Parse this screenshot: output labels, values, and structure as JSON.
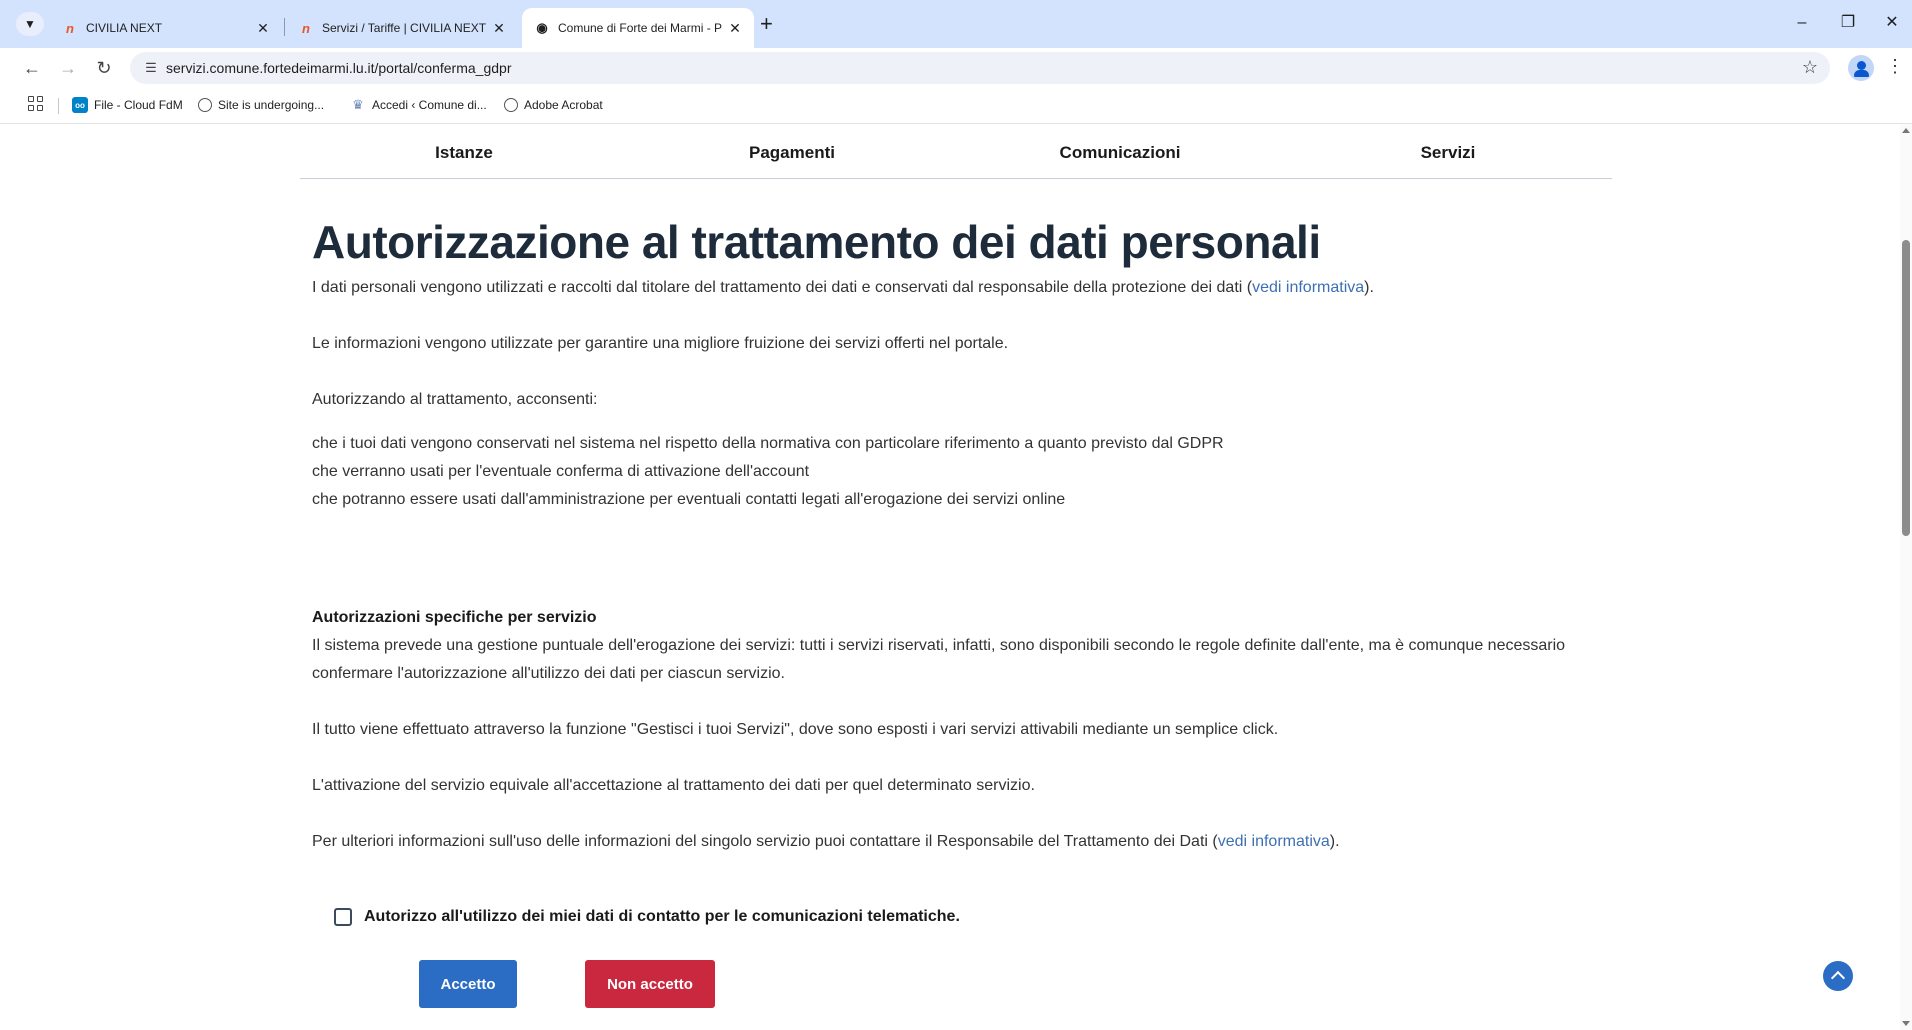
{
  "browser": {
    "tabs": [
      {
        "title": "CIVILIA NEXT",
        "favicon": "civilia-icon",
        "active": false
      },
      {
        "title": "Servizi / Tariffe | CIVILIA NEXT",
        "favicon": "civilia-icon",
        "active": false
      },
      {
        "title": "Comune di Forte dei Marmi - P",
        "favicon": "globe-icon",
        "active": true
      }
    ],
    "url": "servizi.comune.fortedeimarmi.lu.it/portal/conferma_gdpr",
    "bookmarks": [
      {
        "label": "File - Cloud FdM",
        "icon": "nextcloud-icon"
      },
      {
        "label": "Site is undergoing...",
        "icon": "globe-icon"
      },
      {
        "label": "Accedi ‹ Comune di...",
        "icon": "crest-icon"
      },
      {
        "label": "Adobe Acrobat",
        "icon": "globe-icon"
      }
    ]
  },
  "nav": {
    "items": [
      "Istanze",
      "Pagamenti",
      "Comunicazioni",
      "Servizi"
    ]
  },
  "page": {
    "title": "Autorizzazione al trattamento dei dati personali",
    "intro_text": "I dati personali vengono utilizzati e raccolti dal titolare del trattamento dei dati e conservati dal responsabile della protezione dei dati (",
    "intro_link": "vedi informativa",
    "intro_end": ").",
    "info": "Le informazioni vengono utilizzate per garantire una migliore fruizione dei servizi offerti nel portale.",
    "consent_intro": "Autorizzando al trattamento, acconsenti:",
    "consent_items": [
      "che i tuoi dati vengono conservati nel sistema nel rispetto della normativa con particolare riferimento a quanto previsto dal GDPR",
      "che verranno usati per l'eventuale conferma di attivazione dell'account",
      "che potranno essere usati dall'amministrazione per eventuali contatti legati all'erogazione dei servizi online"
    ],
    "specific_title": "Autorizzazioni specifiche per servizio",
    "specific_text": "Il sistema prevede una gestione puntuale dell'erogazione dei servizi: tutti i servizi riservati, infatti, sono disponibili secondo le regole definite dall'ente, ma è comunque necessario confermare l'autorizzazione all'utilizzo dei dati per ciascun servizio.",
    "manage_text": "Il tutto viene effettuato attraverso la funzione \"Gestisci i tuoi Servizi\", dove sono esposti i vari servizi attivabili mediante un semplice click.",
    "activation_text": "L'attivazione del servizio equivale all'accettazione al trattamento dei dati per quel determinato servizio.",
    "contact_text": "Per ulteriori informazioni sull'uso delle informazioni del singolo servizio puoi contattare il Responsabile del Trattamento dei Dati (",
    "contact_link": "vedi informativa",
    "contact_end": ").",
    "checkbox_label": "Autorizzo all'utilizzo dei miei dati di contatto per le comunicazioni telematiche.",
    "accept_label": "Accetto",
    "reject_label": "Non accetto"
  },
  "colors": {
    "accent": "#2b6cc4",
    "danger": "#c9283e",
    "link": "#3d6fb4",
    "title": "#1d2b3a"
  }
}
